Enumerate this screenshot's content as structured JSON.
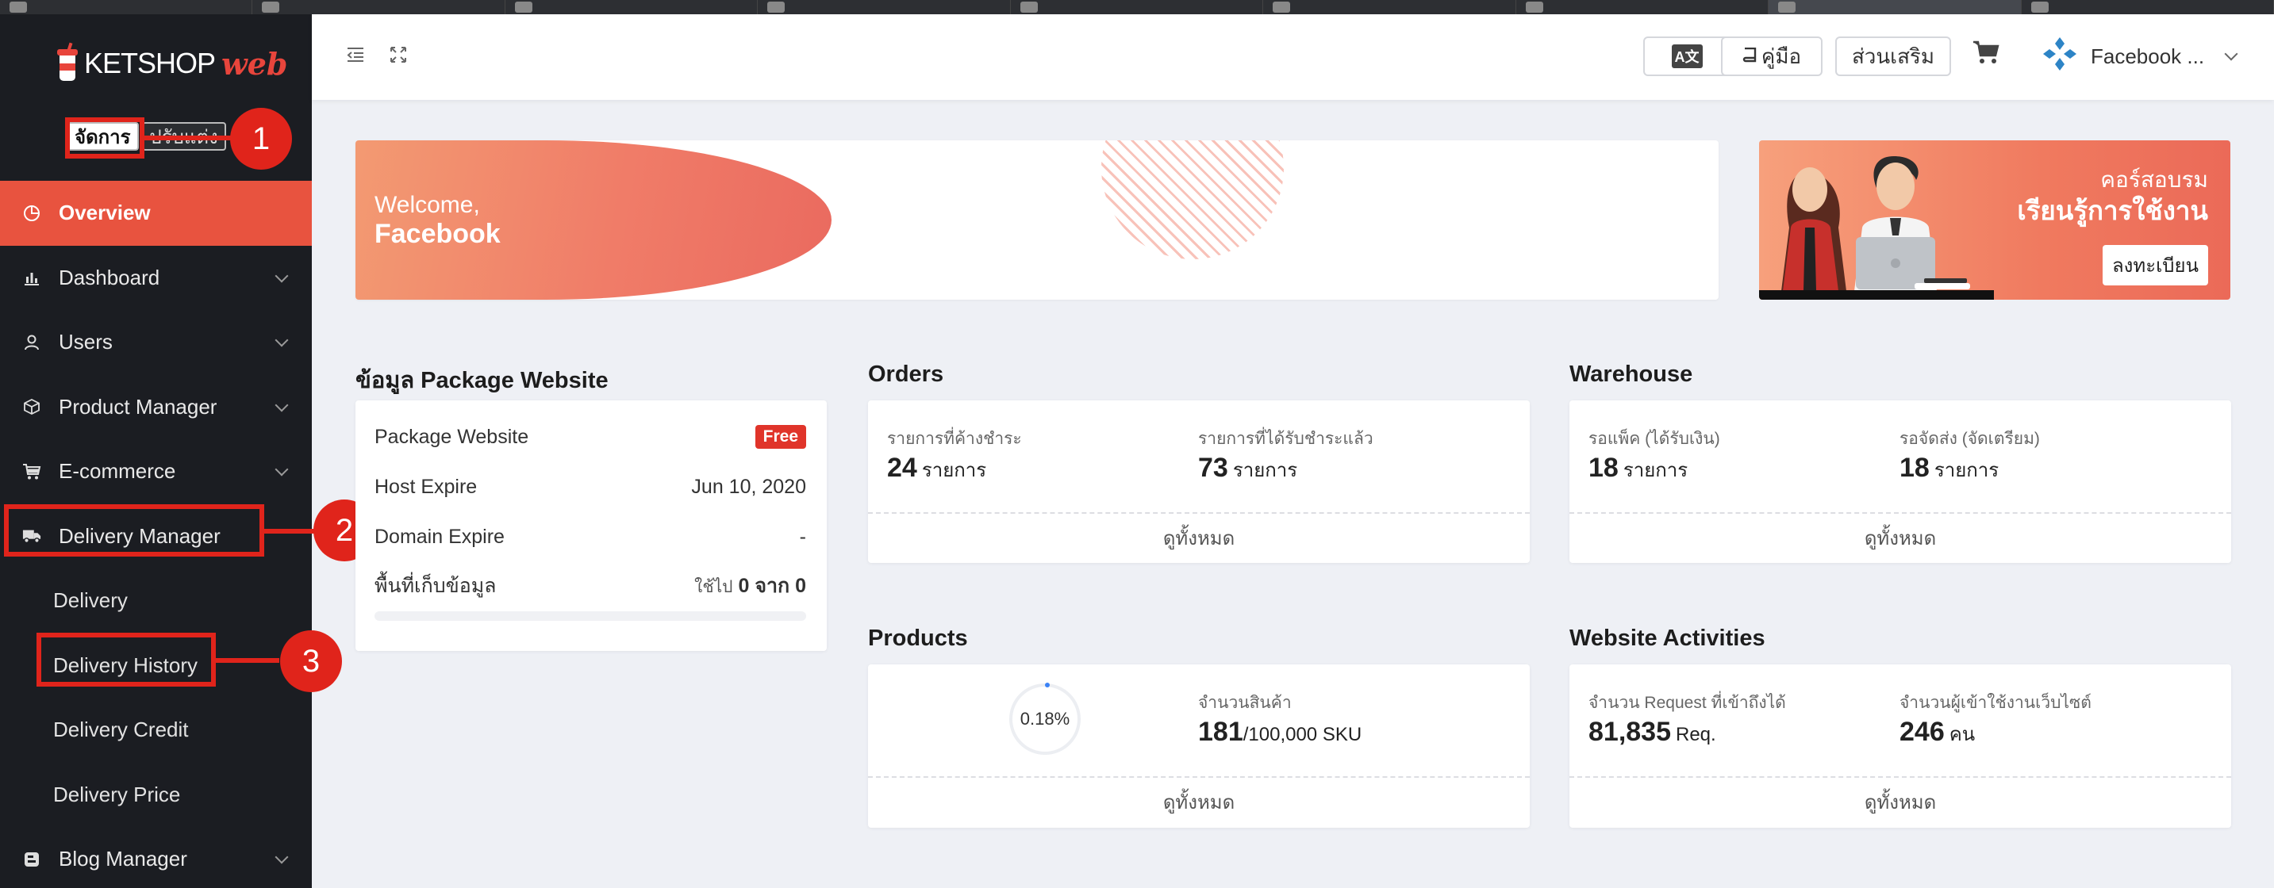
{
  "sidebar": {
    "brand": "KETSHOP",
    "brand_suffix": "web",
    "mode_manage": "จัดการ",
    "mode_settings": "ปรับแต่ง",
    "items": [
      {
        "label": "Overview",
        "active": true
      },
      {
        "label": "Dashboard"
      },
      {
        "label": "Users"
      },
      {
        "label": "Product Manager"
      },
      {
        "label": "E-commerce"
      },
      {
        "label": "Delivery Manager"
      }
    ],
    "delivery_sub": [
      "Delivery",
      "Delivery History",
      "Delivery Credit",
      "Delivery Price"
    ],
    "blog_label": "Blog Manager"
  },
  "callouts": [
    "1",
    "2",
    "3"
  ],
  "header": {
    "lang_label": "A文",
    "manual_label": "คู่มือ",
    "addon_label": "ส่วนเสริม",
    "user_name": "Facebook ..."
  },
  "welcome": {
    "greeting": "Welcome,",
    "name": "Facebook"
  },
  "course": {
    "line1": "คอร์สอบรม",
    "line2": "เรียนรู้การใช้งาน",
    "register": "ลงทะเบียน"
  },
  "package": {
    "title": "ข้อมูล Package Website",
    "package_label": "Package Website",
    "package_value": "Free",
    "host_label": "Host Expire",
    "host_value": "Jun 10, 2020",
    "domain_label": "Domain Expire",
    "domain_value": "-",
    "storage_label": "พื้นที่เก็บข้อมูล",
    "storage_prefix": "ใช้ไป",
    "storage_used": "0",
    "storage_sep": "จาก",
    "storage_total": "0"
  },
  "orders": {
    "title": "Orders",
    "pending_label": "รายการที่ค้างชำระ",
    "pending_value": "24",
    "paid_label": "รายการที่ได้รับชำระแล้ว",
    "paid_value": "73",
    "unit": "รายการ",
    "view_all": "ดูทั้งหมด"
  },
  "warehouse": {
    "title": "Warehouse",
    "pack_label": "รอแพ็ค (ได้รับเงิน)",
    "pack_value": "18",
    "ship_label": "รอจัดส่ง (จัดเตรียม)",
    "ship_value": "18",
    "unit": "รายการ",
    "view_all": "ดูทั้งหมด"
  },
  "products": {
    "title": "Products",
    "ring_value": "0.18%",
    "count_label": "จำนวนสินค้า",
    "count_value": "181",
    "count_limit": "/100,000 SKU",
    "view_all": "ดูทั้งหมด"
  },
  "activities": {
    "title": "Website Activities",
    "req_label": "จำนวน Request ที่เข้าถึงได้",
    "req_value": "81,835",
    "req_unit": "Req.",
    "visitors_label": "จำนวนผู้เข้าใช้งานเว็บไซต์",
    "visitors_value": "246",
    "visitors_unit": "คน",
    "view_all": "ดูทั้งหมด"
  },
  "colors": {
    "accent": "#e8533f",
    "callout": "#e0241b",
    "sidebar_bg": "#1b1d22"
  }
}
